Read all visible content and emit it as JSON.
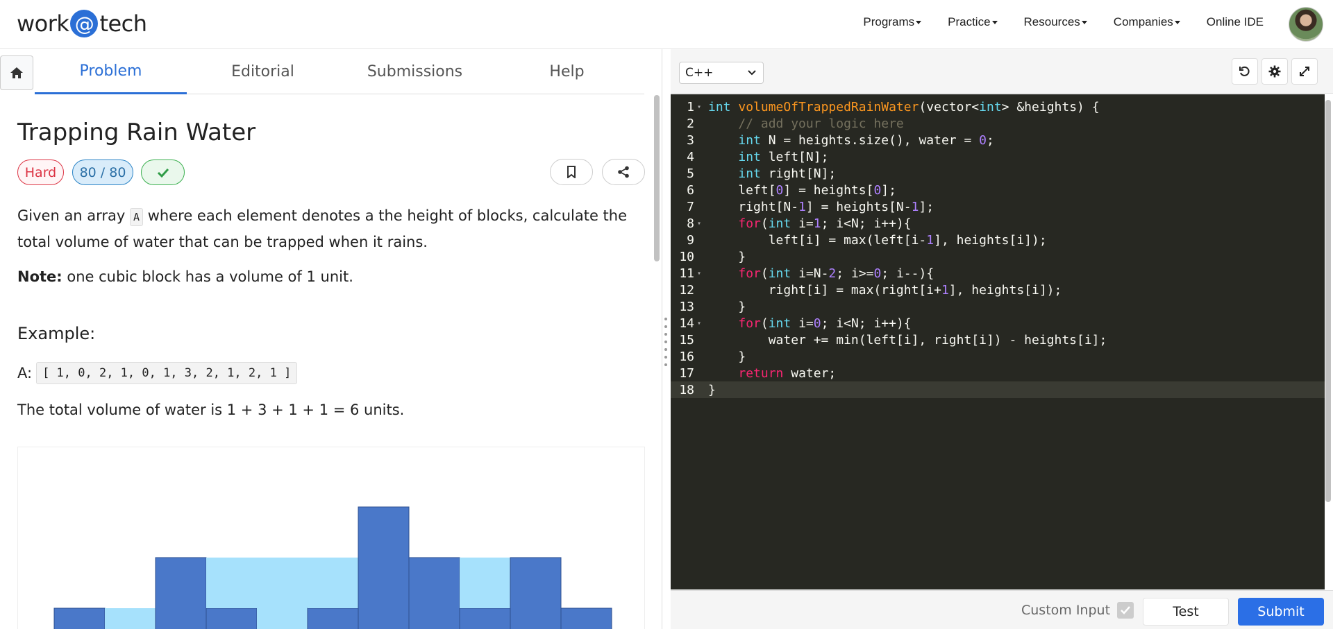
{
  "navbar": {
    "logo_prefix": "work",
    "logo_at": "@",
    "logo_suffix": "tech",
    "items": [
      "Programs",
      "Practice",
      "Resources",
      "Companies",
      "Online IDE"
    ]
  },
  "tabs": [
    "Problem",
    "Editorial",
    "Submissions",
    "Help"
  ],
  "problem": {
    "title": "Trapping Rain Water",
    "difficulty": "Hard",
    "score": "80 / 80",
    "desc_before": "Given an array ",
    "desc_code": "A",
    "desc_after": " where each element denotes a the height of blocks, calculate the total volume of water that can be trapped when it rains.",
    "note_label": "Note:",
    "note_text": " one cubic block has a volume of 1 unit.",
    "example_heading": "Example:",
    "example_label": "A:",
    "example_array": "[ 1, 0, 2, 1, 0, 1, 3, 2, 1, 2, 1 ]",
    "total_text": "The total volume of water is 1 + 3 + 1 + 1 = 6 units."
  },
  "diagram": {
    "heights": [
      1,
      0,
      2,
      1,
      0,
      1,
      3,
      2,
      1,
      2,
      1
    ],
    "water": [
      0,
      1,
      0,
      1,
      2,
      1,
      0,
      0,
      1,
      0,
      0
    ],
    "block_color": "#4a78c9",
    "water_color": "#a6e1fc"
  },
  "editor": {
    "language": "C++",
    "lines": [
      [
        [
          "k",
          "int"
        ],
        [
          "t",
          " "
        ],
        [
          "f",
          "volumeOfTrappedRainWater"
        ],
        [
          "t",
          "(vector<"
        ],
        [
          "k",
          "int"
        ],
        [
          "t",
          "> &heights) {"
        ]
      ],
      [
        [
          "t",
          "    "
        ],
        [
          "c",
          "// add your logic here"
        ]
      ],
      [
        [
          "t",
          "    "
        ],
        [
          "k",
          "int"
        ],
        [
          "t",
          " N = heights.size(), water = "
        ],
        [
          "n",
          "0"
        ],
        [
          "t",
          ";"
        ]
      ],
      [
        [
          "t",
          "    "
        ],
        [
          "k",
          "int"
        ],
        [
          "t",
          " left[N];"
        ]
      ],
      [
        [
          "t",
          "    "
        ],
        [
          "k",
          "int"
        ],
        [
          "t",
          " right[N];"
        ]
      ],
      [
        [
          "t",
          "    left["
        ],
        [
          "n",
          "0"
        ],
        [
          "t",
          "] = heights["
        ],
        [
          "n",
          "0"
        ],
        [
          "t",
          "];"
        ]
      ],
      [
        [
          "t",
          "    right[N-"
        ],
        [
          "n",
          "1"
        ],
        [
          "t",
          "] = heights[N-"
        ],
        [
          "n",
          "1"
        ],
        [
          "t",
          "];"
        ]
      ],
      [
        [
          "t",
          "    "
        ],
        [
          "r",
          "for"
        ],
        [
          "t",
          "("
        ],
        [
          "k",
          "int"
        ],
        [
          "t",
          " i="
        ],
        [
          "n",
          "1"
        ],
        [
          "t",
          "; i<N; i++){"
        ]
      ],
      [
        [
          "t",
          "        left[i] = max(left[i-"
        ],
        [
          "n",
          "1"
        ],
        [
          "t",
          "], heights[i]);"
        ]
      ],
      [
        [
          "t",
          "    }"
        ]
      ],
      [
        [
          "t",
          "    "
        ],
        [
          "r",
          "for"
        ],
        [
          "t",
          "("
        ],
        [
          "k",
          "int"
        ],
        [
          "t",
          " i=N-"
        ],
        [
          "n",
          "2"
        ],
        [
          "t",
          "; i>="
        ],
        [
          "n",
          "0"
        ],
        [
          "t",
          "; i--){"
        ]
      ],
      [
        [
          "t",
          "        right[i] = max(right[i+"
        ],
        [
          "n",
          "1"
        ],
        [
          "t",
          "], heights[i]);"
        ]
      ],
      [
        [
          "t",
          "    }"
        ]
      ],
      [
        [
          "t",
          "    "
        ],
        [
          "r",
          "for"
        ],
        [
          "t",
          "("
        ],
        [
          "k",
          "int"
        ],
        [
          "t",
          " i="
        ],
        [
          "n",
          "0"
        ],
        [
          "t",
          "; i<N; i++){"
        ]
      ],
      [
        [
          "t",
          "        water += min(left[i], right[i]) - heights[i];"
        ]
      ],
      [
        [
          "t",
          "    }"
        ]
      ],
      [
        [
          "t",
          "    "
        ],
        [
          "r",
          "return"
        ],
        [
          "t",
          " water;"
        ]
      ],
      [
        [
          "t",
          "}"
        ]
      ]
    ],
    "fold_lines": [
      1,
      8,
      11,
      14
    ],
    "active_line": 18
  },
  "footer": {
    "custom_input_label": "Custom Input",
    "test_label": "Test",
    "submit_label": "Submit"
  },
  "colors": {
    "accent": "#2b6fd6",
    "hard": "#dc3545",
    "success": "#3bb04f",
    "editor_bg": "#272822"
  }
}
